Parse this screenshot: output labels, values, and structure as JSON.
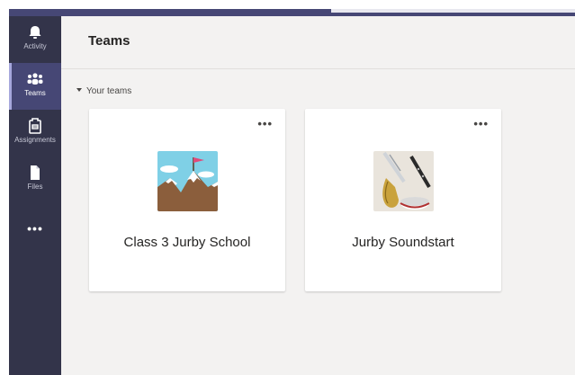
{
  "app_bar": {
    "items": [
      {
        "label": "Activity",
        "icon": "bell-icon"
      },
      {
        "label": "Teams",
        "icon": "teams-icon",
        "active": true
      },
      {
        "label": "Assignments",
        "icon": "assignments-icon"
      },
      {
        "label": "Files",
        "icon": "file-icon"
      }
    ],
    "more_label": "•••"
  },
  "header": {
    "title": "Teams"
  },
  "section": {
    "label": "Your teams"
  },
  "teams": [
    {
      "name": "Class 3 Jurby School",
      "more_label": "•••",
      "avatar": "mountain-flag-image"
    },
    {
      "name": "Jurby Soundstart",
      "more_label": "•••",
      "avatar": "instruments-image"
    }
  ],
  "colors": {
    "rail": "#33344a",
    "rail_active": "#464775",
    "accent": "#6264a7",
    "main_bg": "#f3f2f1",
    "card_bg": "#ffffff"
  }
}
